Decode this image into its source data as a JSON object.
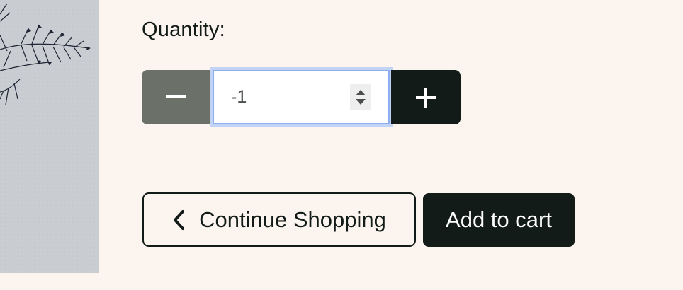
{
  "product": {
    "image_icon": "fern-illustration"
  },
  "quantity": {
    "label": "Quantity:",
    "value": "-1",
    "decrement_icon": "minus-icon",
    "increment_icon": "plus-icon"
  },
  "actions": {
    "continue_label": "Continue Shopping",
    "continue_icon": "chevron-left-icon",
    "add_to_cart_label": "Add to cart"
  },
  "colors": {
    "background": "#fcf4ef",
    "primary_dark": "#121b17",
    "decrement_bg": "#6b7169",
    "focus_ring": "#8aaef0"
  }
}
